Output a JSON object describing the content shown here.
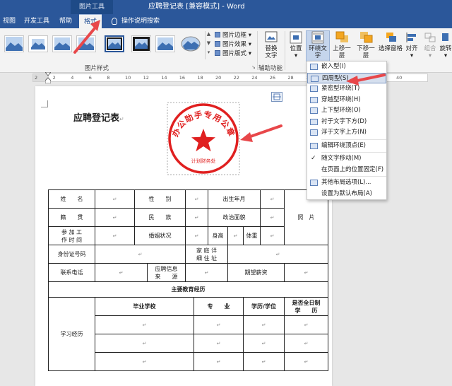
{
  "window": {
    "contextual_tab_group": "图片工具",
    "title": "应聘登记表 [兼容模式] - Word"
  },
  "tabs": [
    {
      "label": "视图"
    },
    {
      "label": "开发工具"
    },
    {
      "label": "帮助"
    },
    {
      "label": "格式"
    }
  ],
  "tell_me": "操作说明搜索",
  "ribbon": {
    "picture_styles_label": "图片样式",
    "picture_border": "图片边框",
    "picture_effects": "图片效果",
    "picture_layout": "图片版式",
    "alt_text_label_1": "替换",
    "alt_text_label_2": "文字",
    "accessibility_label": "辅助功能",
    "position": "位置",
    "wrap_text": "环绕文字",
    "bring_forward": "上移一层",
    "send_backward": "下移一层",
    "selection_pane": "选择窗格",
    "align": "对齐",
    "group": "组合",
    "rotate": "旋转"
  },
  "ruler": {
    "ticks": [
      "2",
      "2",
      "4",
      "6",
      "8",
      "10",
      "12",
      "14",
      "16",
      "18",
      "20",
      "22",
      "24",
      "26",
      "28",
      "30",
      "32",
      "34",
      "36",
      "38",
      "40"
    ]
  },
  "document": {
    "title": "应聘登记表",
    "paragraph_mark": "↵"
  },
  "stamp": {
    "text": "办公助手专用公章",
    "subtext": "计划财务处"
  },
  "table": {
    "name_label": "姓　　名",
    "gender_label": "性　　别",
    "birth_label": "出生年月",
    "native_label": "籍　　贯",
    "ethnic_label": "民　　族",
    "political_label": "政治面貌",
    "work_time_label_1": "参 加 工",
    "work_time_label_2": "作 时 间",
    "marital_label": "婚姻状况",
    "height_label": "身高",
    "weight_label": "体重",
    "photo_label": "照　片",
    "id_label": "身份证号码",
    "address_label_1": "家 庭 详",
    "address_label_2": "细 住 址",
    "phone_label": "联系电话",
    "apply_label_1": "应聘信息",
    "apply_label_2": "来　　源",
    "salary_label": "期望薪资",
    "edu_header": "主要教育经历",
    "school_label": "毕业学校",
    "major_label": "专　　业",
    "degree_label": "学历/学位",
    "fulltime_label_1": "是否全日制",
    "fulltime_label_2": "学　　历",
    "study_label": "学习经历"
  },
  "wrap_menu": {
    "items": [
      {
        "label": "嵌入型(I)"
      },
      {
        "label": "四周型(S)"
      },
      {
        "label": "紧密型环绕(T)"
      },
      {
        "label": "穿越型环绕(H)"
      },
      {
        "label": "上下型环绕(O)"
      },
      {
        "label": "衬于文字下方(D)"
      },
      {
        "label": "浮于文字上方(N)"
      },
      {
        "label": "编辑环绕顶点(E)"
      },
      {
        "label": "随文字移动(M)"
      },
      {
        "label": "在页面上的位置固定(F)"
      },
      {
        "label": "其他布局选项(L)..."
      },
      {
        "label": "设置为默认布局(A)"
      }
    ],
    "checked_icon": "✓"
  },
  "colors": {
    "word_blue": "#2b579a",
    "stamp_red": "#e02020",
    "arrow_red": "#e8474a",
    "menu_highlight": "#d5dfee"
  }
}
